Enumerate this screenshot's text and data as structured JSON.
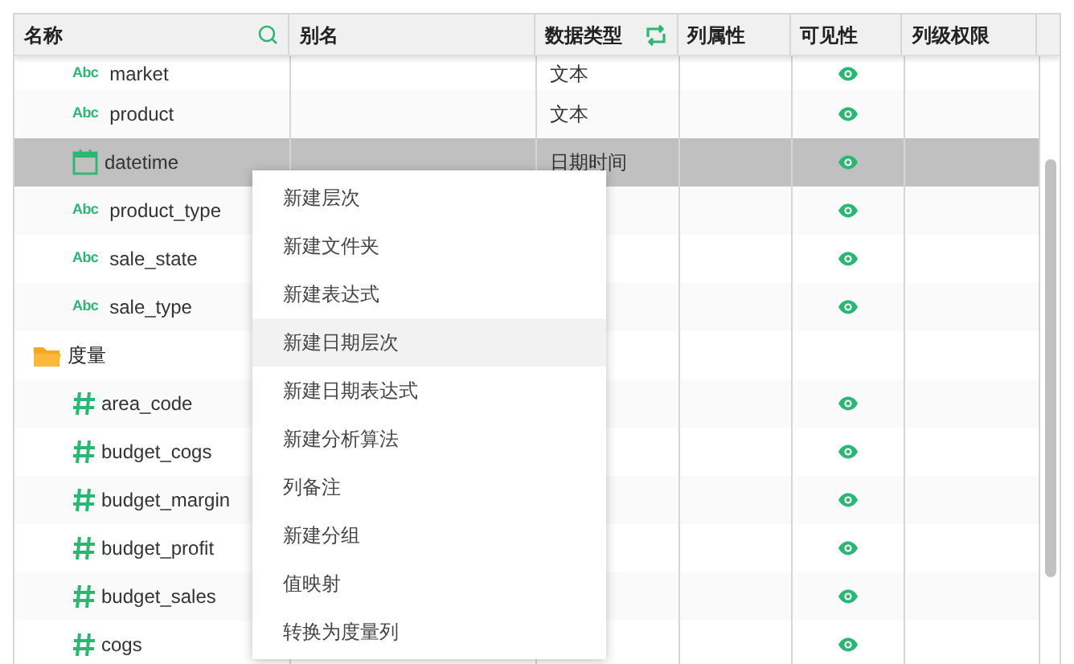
{
  "table": {
    "columns": [
      {
        "label": "名称"
      },
      {
        "label": "别名"
      },
      {
        "label": "数据类型"
      },
      {
        "label": "列属性"
      },
      {
        "label": "可见性"
      },
      {
        "label": "列级权限"
      }
    ],
    "rows": [
      {
        "kind": "text",
        "badge": "Abc",
        "name": "market",
        "type": "文本",
        "visible": true,
        "selected": false
      },
      {
        "kind": "text",
        "badge": "Abc",
        "name": "product",
        "type": "文本",
        "visible": true,
        "selected": false
      },
      {
        "kind": "date",
        "name": "datetime",
        "type": "日期时间",
        "visible": true,
        "selected": true
      },
      {
        "kind": "text",
        "badge": "Abc",
        "name": "product_type",
        "visible": true,
        "selected": false
      },
      {
        "kind": "text",
        "badge": "Abc",
        "name": "sale_state",
        "visible": true,
        "selected": false
      },
      {
        "kind": "text",
        "badge": "Abc",
        "name": "sale_type",
        "visible": true,
        "selected": false
      },
      {
        "kind": "folder",
        "label": "度量",
        "selected": false,
        "children": [
          {
            "kind": "number",
            "name": "area_code",
            "visible": true,
            "selected": false
          },
          {
            "kind": "number",
            "name": "budget_cogs",
            "visible": true,
            "selected": false
          },
          {
            "kind": "number",
            "name": "budget_margin",
            "visible": true,
            "selected": false
          },
          {
            "kind": "number",
            "name": "budget_profit",
            "visible": true,
            "selected": false
          },
          {
            "kind": "number",
            "name": "budget_sales",
            "visible": true,
            "selected": false
          },
          {
            "kind": "number",
            "name": "cogs",
            "visible": true,
            "selected": false
          }
        ]
      }
    ]
  },
  "context_menu": [
    {
      "label": "新建层次",
      "selected": false
    },
    {
      "label": "新建文件夹",
      "selected": false
    },
    {
      "label": "新建表达式",
      "selected": false
    },
    {
      "label": "新建日期层次",
      "selected": true
    },
    {
      "label": "新建日期表达式",
      "selected": false
    },
    {
      "label": "新建分析算法",
      "selected": false
    },
    {
      "label": "列备注",
      "selected": false
    },
    {
      "label": "新建分组",
      "selected": false
    },
    {
      "label": "值映射",
      "selected": false
    },
    {
      "label": "转换为度量列",
      "selected": false
    }
  ]
}
